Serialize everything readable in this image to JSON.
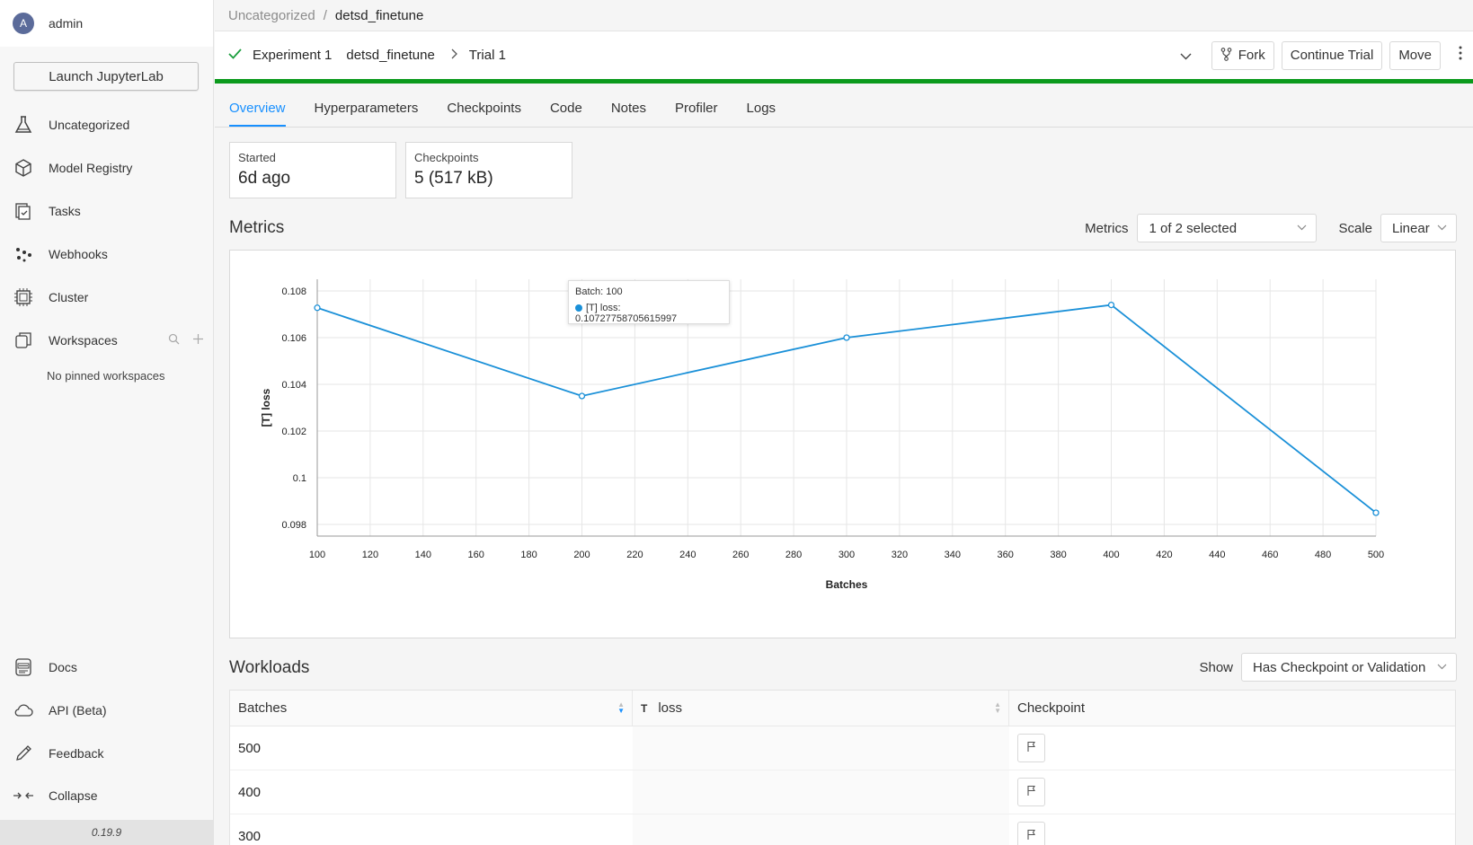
{
  "user": {
    "initial": "A",
    "name": "admin"
  },
  "sidebar": {
    "launch_label": "Launch JupyterLab",
    "items": [
      {
        "label": "Uncategorized",
        "icon": "flask-icon"
      },
      {
        "label": "Model Registry",
        "icon": "cube-icon"
      },
      {
        "label": "Tasks",
        "icon": "tasks-icon"
      },
      {
        "label": "Webhooks",
        "icon": "webhooks-icon"
      },
      {
        "label": "Cluster",
        "icon": "cluster-icon"
      },
      {
        "label": "Workspaces",
        "icon": "workspaces-icon"
      }
    ],
    "no_pinned": "No pinned workspaces",
    "bottom_items": [
      {
        "label": "Docs",
        "icon": "docs-icon"
      },
      {
        "label": "API (Beta)",
        "icon": "cloud-icon"
      },
      {
        "label": "Feedback",
        "icon": "pencil-icon"
      },
      {
        "label": "Collapse",
        "icon": "collapse-icon"
      }
    ],
    "version": "0.19.9"
  },
  "breadcrumb": {
    "parent": "Uncategorized",
    "separator": "/",
    "current": "detsd_finetune"
  },
  "header": {
    "experiment": "Experiment 1",
    "experiment_name": "detsd_finetune",
    "trial": "Trial 1",
    "fork_label": "Fork",
    "continue_label": "Continue Trial",
    "move_label": "Move",
    "progress": 1.0,
    "progress_color": "#0b9a1c"
  },
  "tabs": [
    "Overview",
    "Hyperparameters",
    "Checkpoints",
    "Code",
    "Notes",
    "Profiler",
    "Logs"
  ],
  "active_tab": "Overview",
  "cards": {
    "started": {
      "title": "Started",
      "value": "6d ago"
    },
    "checkpoints": {
      "title": "Checkpoints",
      "value": "5 (517 kB)"
    }
  },
  "metrics": {
    "title": "Metrics",
    "metrics_label": "Metrics",
    "metrics_value": "1 of 2 selected",
    "scale_label": "Scale",
    "scale_value": "Linear"
  },
  "chart_data": {
    "type": "line",
    "xlabel": "Batches",
    "ylabel": "[T] loss",
    "x": [
      100,
      200,
      300,
      400,
      500
    ],
    "series": [
      {
        "values": [
          0.10727758705615997,
          0.1035,
          0.106,
          0.1074,
          0.0985
        ],
        "color": "#1a90d8"
      }
    ],
    "xlim": [
      100,
      500
    ],
    "ylim": [
      0.0975,
      0.1085
    ],
    "xticks": [
      100,
      120,
      140,
      160,
      180,
      200,
      220,
      240,
      260,
      280,
      300,
      320,
      340,
      360,
      380,
      400,
      420,
      440,
      460,
      480,
      500
    ],
    "yticks": [
      0.098,
      0.1,
      0.102,
      0.104,
      0.106,
      0.108
    ],
    "ytick_labels": [
      "0.098",
      "0.1",
      "0.102",
      "0.104",
      "0.106",
      "0.108"
    ],
    "grid": true,
    "tooltip": {
      "title": "Batch: 100",
      "line": "[T] loss: 0.10727758705615997"
    }
  },
  "workloads": {
    "title": "Workloads",
    "show_label": "Show",
    "show_value": "Has Checkpoint or Validation",
    "columns": [
      "Batches",
      "loss",
      "Checkpoint"
    ],
    "loss_prefix": "T",
    "rows": [
      {
        "batches": "500"
      },
      {
        "batches": "400"
      },
      {
        "batches": "300"
      }
    ]
  }
}
